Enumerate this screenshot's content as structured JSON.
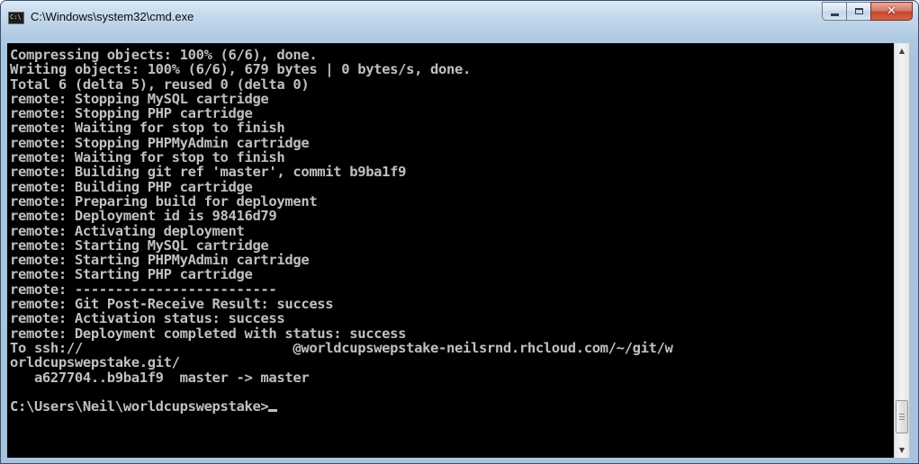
{
  "window": {
    "title": "C:\\Windows\\system32\\cmd.exe",
    "icon": "cmd-icon",
    "icon_text": "C:\\",
    "buttons": {
      "minimize": "minimize-icon",
      "maximize": "maximize-icon",
      "close": "close-icon"
    }
  },
  "console": {
    "lines": [
      "Compressing objects: 100% (6/6), done.",
      "Writing objects: 100% (6/6), 679 bytes | 0 bytes/s, done.",
      "Total 6 (delta 5), reused 0 (delta 0)",
      "remote: Stopping MySQL cartridge",
      "remote: Stopping PHP cartridge",
      "remote: Waiting for stop to finish",
      "remote: Stopping PHPMyAdmin cartridge",
      "remote: Waiting for stop to finish",
      "remote: Building git ref 'master', commit b9ba1f9",
      "remote: Building PHP cartridge",
      "remote: Preparing build for deployment",
      "remote: Deployment id is 98416d79",
      "remote: Activating deployment",
      "remote: Starting MySQL cartridge",
      "remote: Starting PHPMyAdmin cartridge",
      "remote: Starting PHP cartridge",
      "remote: -------------------------",
      "remote: Git Post-Receive Result: success",
      "remote: Activation status: success",
      "remote: Deployment completed with status: success",
      "To ssh://                          @worldcupswepstake-neilsrnd.rhcloud.com/~/git/w",
      "orldcupswepstake.git/",
      "   a627704..b9ba1f9  master -> master",
      ""
    ],
    "prompt": "C:\\Users\\Neil\\worldcupswepstake>"
  },
  "colors": {
    "console_background": "#000000",
    "console_text": "#c0c0c0",
    "close_button": "#c7462d"
  }
}
